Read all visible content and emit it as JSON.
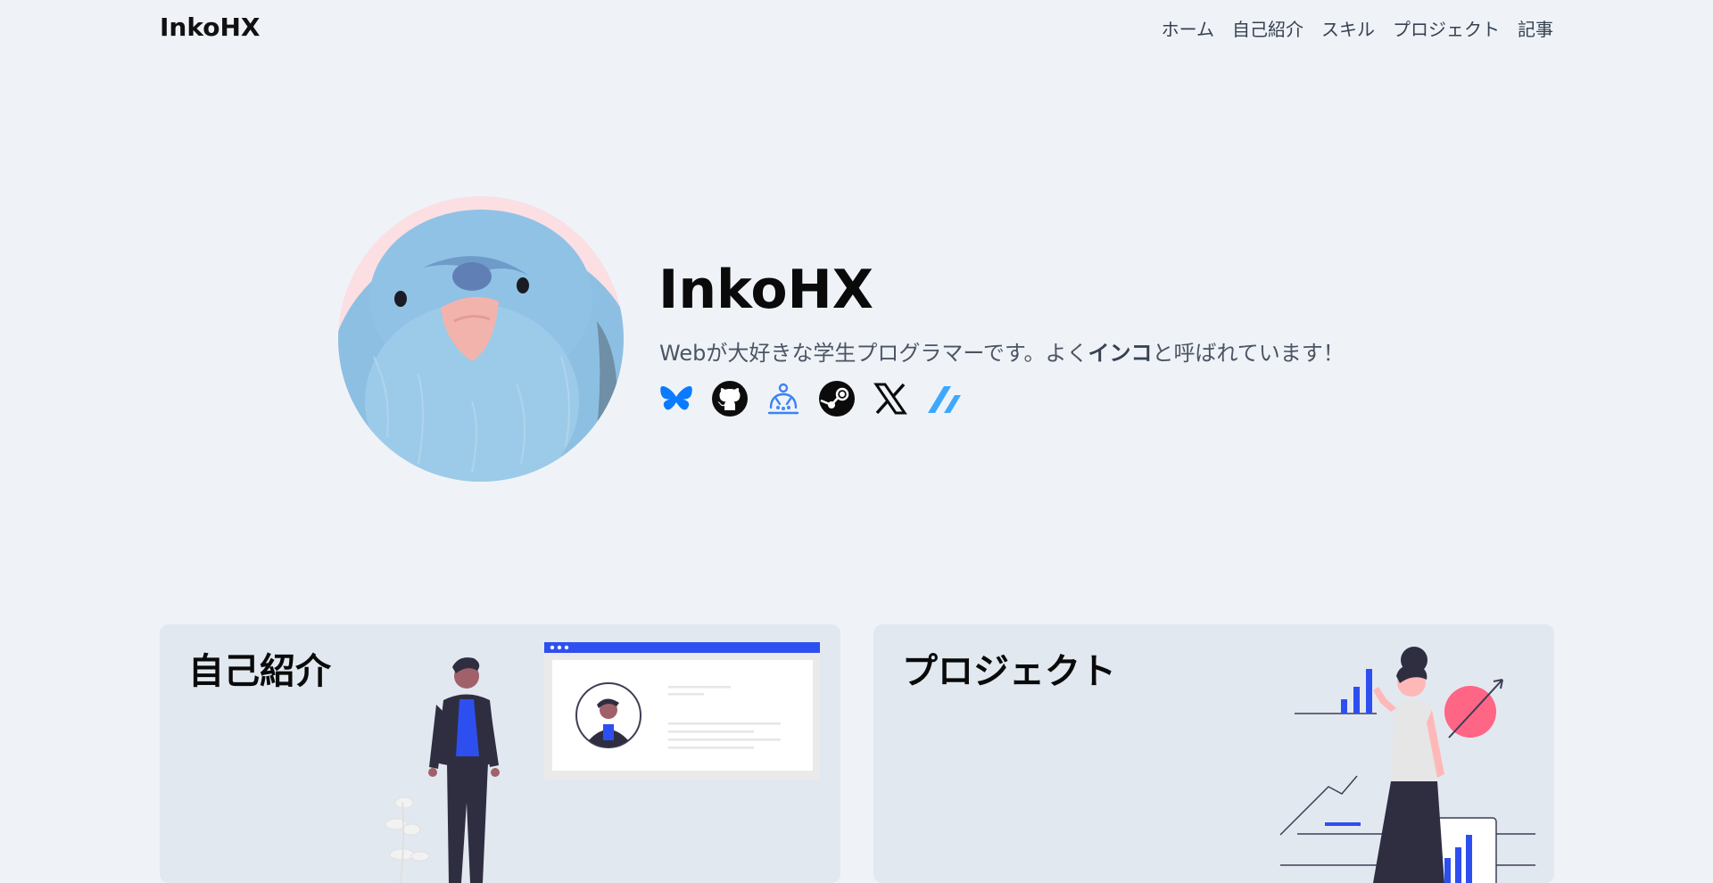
{
  "header": {
    "logo": "InkoHX",
    "nav": [
      "ホーム",
      "自己紹介",
      "スキル",
      "プロジェクト",
      "記事"
    ]
  },
  "hero": {
    "name": "InkoHX",
    "tagline_before": "Webが大好きな学生プログラマーです。よく",
    "tagline_bold": "インコ",
    "tagline_after": "と呼ばれています！",
    "socials": [
      "bluesky-icon",
      "github-icon",
      "misskey-icon",
      "steam-icon",
      "x-icon",
      "zenn-icon"
    ]
  },
  "cards": {
    "about_title": "自己紹介",
    "projects_title": "プロジェクト"
  },
  "colors": {
    "background": "#eff3f8",
    "card": "#e2e8f0",
    "accent_blue": "#2e4ff0",
    "accent_pink": "#ff6584",
    "parakeet": "#8dbfe2"
  }
}
